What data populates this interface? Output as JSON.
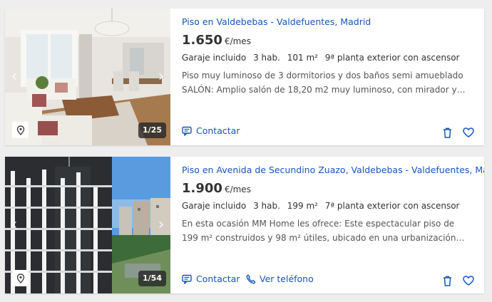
{
  "listings": [
    {
      "title": "Piso en Valdebebas - Valdefuentes, Madrid",
      "price": "1.650",
      "price_unit": "€/mes",
      "details": [
        "Garaje incluido",
        "3 hab.",
        "101 m²",
        "9ª planta exterior con ascensor"
      ],
      "description": "Piso muy luminoso de 3 dormitorios y dos baños semi amueblado SALÓN: Amplio salón de 18,20 m2 muy luminoso, con mirador y una gran ventana. S...",
      "photo_counter": "1/25",
      "contact_label": "Contactar"
    },
    {
      "title": "Piso en Avenida de Secundino Zuazo, Valdebebas - Valdefuentes, Madrid",
      "price": "1.900",
      "price_unit": "€/mes",
      "details": [
        "Garaje incluido",
        "3 hab.",
        "199 m²",
        "7ª planta exterior con ascensor"
      ],
      "description": "En esta ocasión MM Home les ofrece: Este espectacular piso de 199 m² construidos y 98 m² útiles, ubicado en una urbanización privada que ofrece...",
      "photo_counter": "1/54",
      "contact_label": "Contactar",
      "phone_label": "Ver teléfono"
    }
  ],
  "colors": {
    "link_blue": "#1556b8",
    "background": "#eeeeee"
  },
  "icons": [
    "chevron-left-icon",
    "chevron-right-icon",
    "map-pin-icon",
    "chat-icon",
    "phone-icon",
    "trash-icon",
    "heart-icon"
  ]
}
